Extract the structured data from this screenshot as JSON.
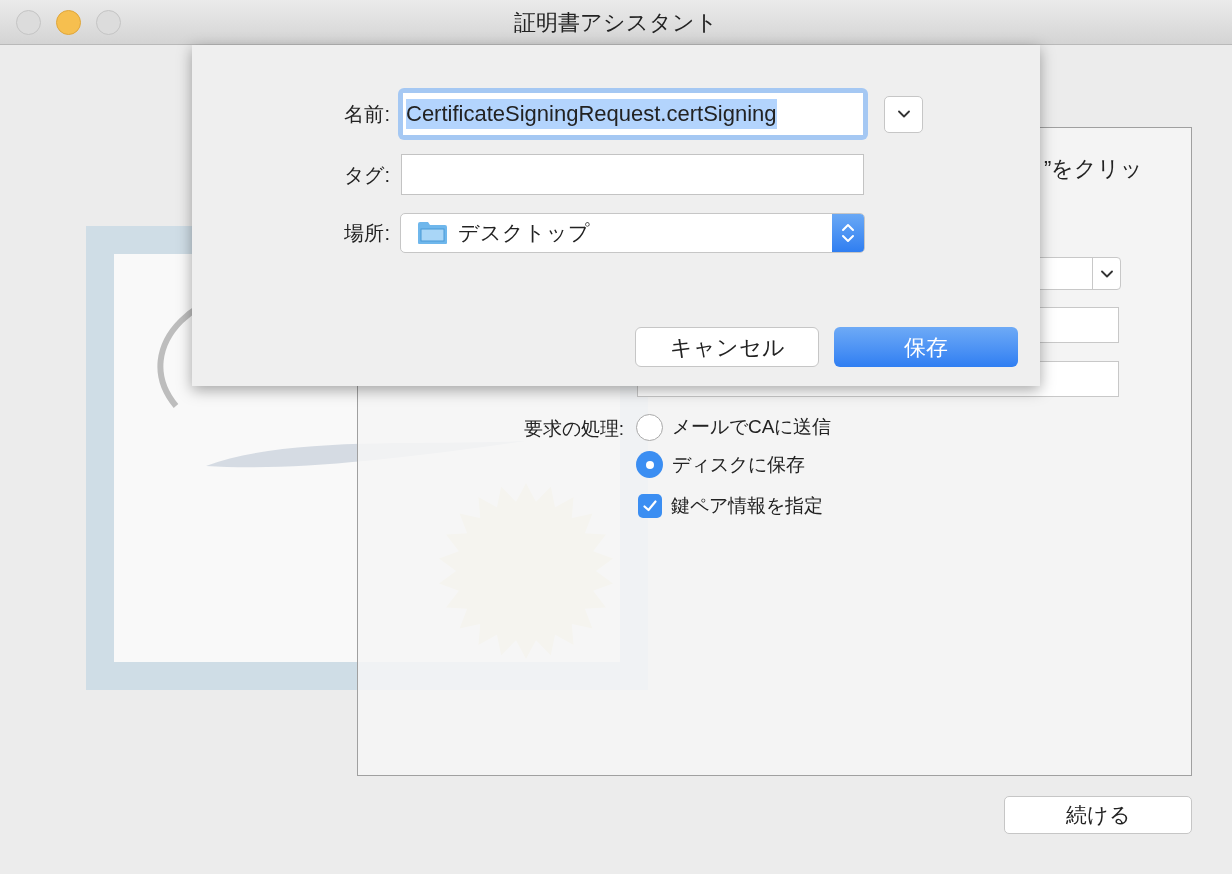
{
  "window": {
    "title": "証明書アシスタント"
  },
  "assistant": {
    "instruction_fragment": "”をクリッ",
    "request_handling": {
      "label": "要求の処理:",
      "options": [
        {
          "label": "メールでCAに送信",
          "selected": false
        },
        {
          "label": "ディスクに保存",
          "selected": true
        }
      ]
    },
    "key_pair": {
      "label": "鍵ペア情報を指定",
      "checked": true
    },
    "continue_button": "続ける"
  },
  "save_sheet": {
    "name": {
      "label": "名前:",
      "value": "CertificateSigningRequest.certSigning",
      "selected": true
    },
    "tags": {
      "label": "タグ:"
    },
    "location": {
      "label": "場所:",
      "value": "デスクトップ"
    },
    "buttons": [
      {
        "label": "キャンセル",
        "kind": "secondary"
      },
      {
        "label": "保存",
        "kind": "default"
      }
    ]
  }
}
